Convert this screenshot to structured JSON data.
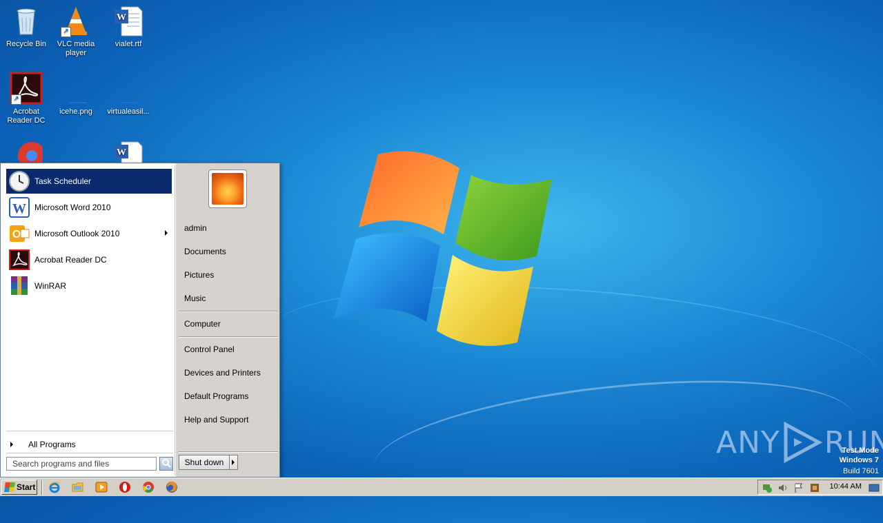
{
  "desktop": {
    "icons": [
      {
        "label": "Recycle Bin",
        "icon": "recycle-bin-icon"
      },
      {
        "label": "VLC media player",
        "icon": "vlc-icon"
      },
      {
        "label": "vialet.rtf",
        "icon": "word-document-icon"
      },
      {
        "label": "Acrobat Reader DC",
        "icon": "acrobat-icon"
      },
      {
        "label": "icehe.png",
        "icon": "image-file-icon"
      },
      {
        "label": "virtualeasil...",
        "icon": "file-icon"
      },
      {
        "label": "",
        "icon": "chrome-icon"
      },
      {
        "label": "",
        "icon": "word-document-icon"
      }
    ]
  },
  "start_menu": {
    "programs": [
      {
        "label": "Task Scheduler",
        "icon": "clock-icon",
        "selected": true
      },
      {
        "label": "Microsoft Word 2010",
        "icon": "word-icon"
      },
      {
        "label": "Microsoft Outlook 2010",
        "icon": "outlook-icon",
        "has_submenu": true
      },
      {
        "label": "Acrobat Reader DC",
        "icon": "acrobat-icon"
      },
      {
        "label": "WinRAR",
        "icon": "winrar-icon"
      }
    ],
    "all_programs": "All Programs",
    "search_placeholder": "Search programs and files",
    "right": {
      "user": "admin",
      "documents": "Documents",
      "pictures": "Pictures",
      "music": "Music",
      "computer": "Computer",
      "control_panel": "Control Panel",
      "devices": "Devices and Printers",
      "default_programs": "Default Programs",
      "help": "Help and Support"
    },
    "shutdown": "Shut down"
  },
  "taskbar": {
    "start": "Start",
    "quick_launch": [
      "internet-explorer-icon",
      "explorer-folder-icon",
      "media-player-icon",
      "opera-icon",
      "chrome-icon",
      "firefox-icon"
    ],
    "tray_icons": [
      "network-icon",
      "volume-icon",
      "flag-icon",
      "network-adapter-icon"
    ],
    "clock": "10:44 AM"
  },
  "watermark": {
    "line1": "Test Mode",
    "line2": "Windows 7",
    "line3": "Build 7601",
    "brand": "ANY RUN"
  },
  "colors": {
    "selection": "#0b2a6b",
    "taskbar": "#d4d0c8",
    "desktop_blue": "#1c8ad6"
  }
}
